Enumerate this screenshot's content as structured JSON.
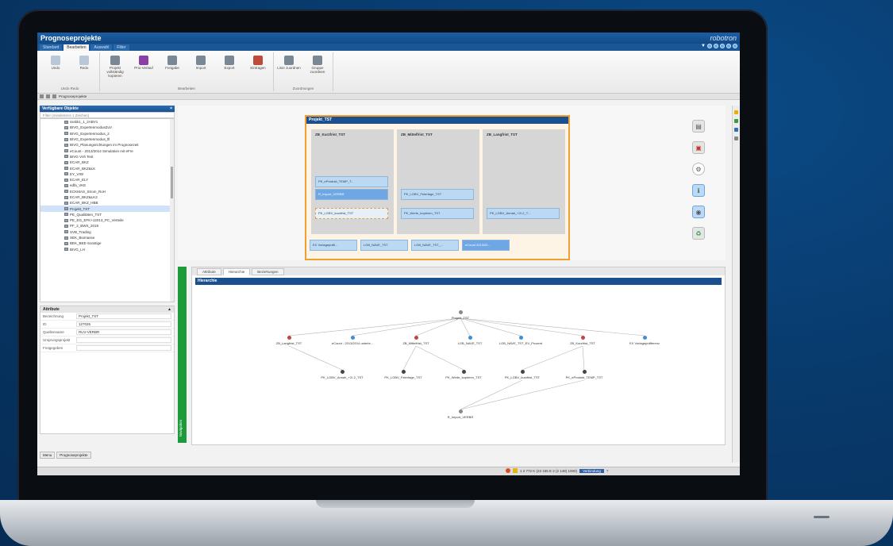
{
  "app": {
    "title": "Prognoseprojekte",
    "brand": "robotron"
  },
  "tabs": [
    "Standard",
    "Bearbeiten",
    "Auswahl",
    "Filter"
  ],
  "ribbon": {
    "groups": [
      {
        "label": "Undo Redo",
        "buttons": [
          {
            "label": "Undo",
            "color": "#b9c7d6"
          },
          {
            "label": "Redo",
            "color": "#b9c7d6"
          }
        ]
      },
      {
        "label": "Bearbeiten",
        "buttons": [
          {
            "label": "Projekt vollständig kopieren",
            "color": "#7a8794"
          },
          {
            "label": "Prio-Verlauf",
            "color": "#8b3fa3"
          },
          {
            "label": "Freigabe",
            "color": "#7a8794"
          },
          {
            "label": "Import",
            "color": "#7a8794"
          },
          {
            "label": "Export",
            "color": "#7a8794"
          },
          {
            "label": "Eintragen",
            "color": "#c04a3a"
          }
        ]
      },
      {
        "label": "Zuordnungen",
        "buttons": [
          {
            "label": "Linie zuordnen",
            "color": "#7a8794"
          },
          {
            "label": "Gruppe zuordnen",
            "color": "#7a8794"
          }
        ]
      }
    ]
  },
  "breadcrumb": "Prognoseprojekte",
  "left_panel": {
    "title": "Verfügbare Objekte",
    "filter_placeholder": "Filter (mindestens 1 Zeichen)",
    "items": [
      "ssskk1_1_2ABV1",
      "BIVG_ExpertenmodusZuV",
      "BIVG_Expertenmodus_2",
      "BIVG_Expertenmodus_lll",
      "BIVG_Planungsrichtungen im Prognosezeit",
      "eCount - 2013/2014 Simulation mit eFre",
      "BIVG Vnh Test",
      "ECAR_BKZ",
      "ECAR_BKZ&LK",
      "EY_VIW",
      "ECAR_ELY",
      "edfa_VKE",
      "ECKMAS_Strom_RoH",
      "ECAR_BKZ&LK2",
      "ECAR_BKZ_HBB",
      "Projekt_TST",
      "PE_Qualitäten_TST",
      "PE_EG_EFK+12013_PC_Verteile",
      "PF_2_BWS_2019",
      "SVB_Trading",
      "SEK_Biomasse",
      "BEK_BEE-Sonstige",
      "BIVG_LH"
    ],
    "selected_index": 15
  },
  "attributes": {
    "title": "Attribute",
    "rows": [
      {
        "key": "Bezeichnung",
        "value": "Projekt_TST"
      },
      {
        "key": "ID",
        "value": "127026"
      },
      {
        "key": "Quellenname",
        "value": "RUV-VERBR"
      },
      {
        "key": "Ursprungsprojekt",
        "value": ""
      },
      {
        "key": "Freigegeben",
        "value": ""
      }
    ]
  },
  "left_tabs": [
    "Menu",
    "Prognoseprojekte"
  ],
  "project": {
    "title": "Projekt_TST",
    "columns": [
      {
        "title": "ZB_Kurzfrist_TST",
        "chips": [
          "PK_eProdukt_TEMP_T...",
          "R_Import_VERBR",
          "PK_LGBV_kurzfrist_TST"
        ]
      },
      {
        "title": "ZB_Mittelfrist_TST",
        "chips": [
          "PK_LGBV_Feiertage_TST",
          "PK_Werte_kopieren_TST"
        ]
      },
      {
        "title": "ZB_Langfrist_TST",
        "chips": [
          "PK_LGBV_Annah_+2/-2_T..."
        ]
      }
    ],
    "bottom_chips": [
      "EX Vorlagepräfi...",
      "LGB_NAVE_TST",
      "LGB_NAVE_TST_...",
      "eCount 2013/20..."
    ]
  },
  "bottom": {
    "tabs": [
      "Attribute",
      "Hierarchie",
      "Beziehungen"
    ],
    "active_tab": 1,
    "section": "Hierarchie",
    "nav_label": "Navigation",
    "nodes": {
      "root": "Projekt_TST",
      "level1": [
        "ZB_Langfrist_TST",
        "eCount - 2013/2014 unterle...",
        "ZB_Mittelfrist_TST",
        "LGB_NAVE_TST",
        "LGB_NAVE_TST_EV_Prozent",
        "ZB_Kurzfrist_TST",
        "EX Vorlagepräfferenz"
      ],
      "level2": [
        "PK_LGBV_Annah_+2/-2_TST",
        "PK_LGBV_Feiertage_TST",
        "PK_Werte_kopieren_TST",
        "PK_LGBV_kurzfrist_TST",
        "PK_eProdukt_TEMP_TST"
      ],
      "level3": "R_Import_VERBR"
    }
  },
  "status": {
    "text": "1 2 772 K (23 155 E 2 (2 148) 1000)",
    "highlight": "Verbindung",
    "page": "?"
  }
}
